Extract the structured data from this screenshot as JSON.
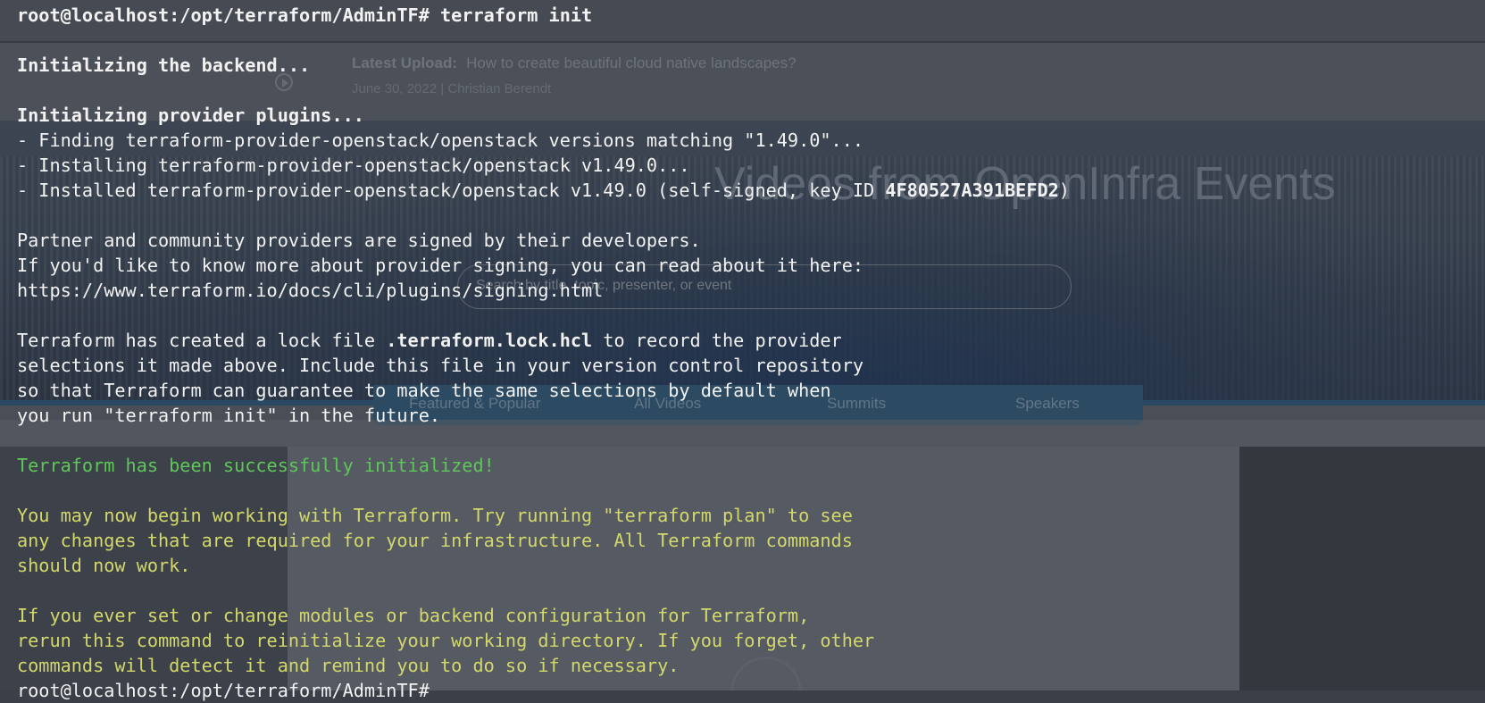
{
  "background_page": {
    "latest_upload_label": "Latest Upload:",
    "latest_upload_title": "How to create beautiful cloud native landscapes?",
    "latest_upload_meta": "June 30, 2022 | Christian Berendt",
    "hero_title": "Videos from OpenInfra Events",
    "search_placeholder": "Search by title, topic, presenter, or event",
    "tabs": [
      "Featured & Popular",
      "All Videos",
      "Summits",
      "Speakers"
    ]
  },
  "terminal": {
    "prompt_top": "root@localhost:/opt/terraform/AdminTF# terraform init",
    "init_backend": "Initializing the backend...",
    "init_plugins": "Initializing provider plugins...",
    "finding": "- Finding terraform-provider-openstack/openstack versions matching \"1.49.0\"...",
    "installing": "- Installing terraform-provider-openstack/openstack v1.49.0...",
    "installed": "- Installed terraform-provider-openstack/openstack v1.49.0 (self-signed, key ID ",
    "key_id": "4F80527A391BEFD2",
    "installed_end": ")",
    "partner": "Partner and community providers are signed by their developers.",
    "signing_more": "If you'd like to know more about provider signing, you can read about it here:",
    "signing_url": "https://www.terraform.io/docs/cli/plugins/signing.html",
    "lock_1a": "Terraform has created a lock file ",
    "lock_file": ".terraform.lock.hcl",
    "lock_1b": " to record the provider",
    "lock_2": "selections it made above. Include this file in your version control repository",
    "lock_3": "so that Terraform can guarantee to make the same selections by default when",
    "lock_4": "you run \"terraform init\" in the future.",
    "success": "Terraform has been successfully initialized!",
    "now_1": "You may now begin working with Terraform. Try running \"terraform plan\" to see",
    "now_2": "any changes that are required for your infrastructure. All Terraform commands",
    "now_3": "should now work.",
    "ever_1": "If you ever set or change modules or backend configuration for Terraform,",
    "ever_2": "rerun this command to reinitialize your working directory. If you forget, other",
    "ever_3": "commands will detect it and remind you to do so if necessary.",
    "prompt_bottom": "root@localhost:/opt/terraform/AdminTF#"
  },
  "colors": {
    "terminal_text": "#f2f2f2",
    "success_green": "#5fc75a",
    "info_yellow": "#d4d86a",
    "tab_bar": "#2c4a62"
  }
}
